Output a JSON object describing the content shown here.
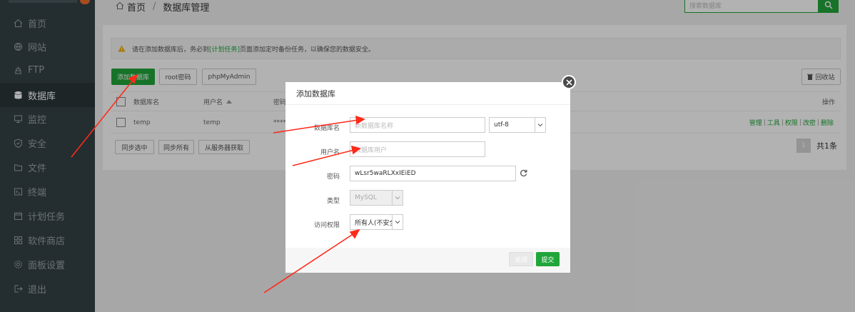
{
  "sidebar": {
    "items": [
      {
        "label": "首页",
        "icon": "home-icon"
      },
      {
        "label": "网站",
        "icon": "globe-icon"
      },
      {
        "label": "FTP",
        "icon": "ftp-icon"
      },
      {
        "label": "数据库",
        "icon": "database-icon",
        "active": true
      },
      {
        "label": "监控",
        "icon": "monitor-icon"
      },
      {
        "label": "安全",
        "icon": "shield-icon"
      },
      {
        "label": "文件",
        "icon": "folder-icon"
      },
      {
        "label": "终端",
        "icon": "terminal-icon"
      },
      {
        "label": "计划任务",
        "icon": "calendar-icon"
      },
      {
        "label": "软件商店",
        "icon": "grid-icon"
      },
      {
        "label": "面板设置",
        "icon": "gear-icon"
      },
      {
        "label": "退出",
        "icon": "logout-icon"
      }
    ]
  },
  "header": {
    "breadcrumb_home": "首页",
    "breadcrumb_sep": "/",
    "breadcrumb_current": "数据库管理",
    "search_placeholder": "搜索数据库"
  },
  "alert": {
    "text_before": "请在添加数据库后，务必到",
    "link": "[计划任务]",
    "text_after": "页面添加定时备份任务，以确保您的数据安全。"
  },
  "toolbar": {
    "add_db": "添加数据库",
    "root_pwd": "root密码",
    "phpmyadmin": "phpMyAdmin",
    "recycle": "回收站"
  },
  "table": {
    "headers": {
      "name": "数据库名",
      "user": "用户名",
      "password": "密码",
      "ops": "操作"
    },
    "rows": [
      {
        "name": "temp",
        "user": "temp",
        "password": "****",
        "ops": [
          "管理",
          "工具",
          "权限",
          "改密",
          "删除"
        ]
      }
    ]
  },
  "bottom": {
    "sync_selected": "同步选中",
    "sync_all": "同步所有",
    "fetch_server": "从服务器获取",
    "page": "1",
    "total": "共1条"
  },
  "modal": {
    "title": "添加数据库",
    "name_label": "数据库名",
    "name_placeholder": "新数据库名称",
    "charset": "utf-8",
    "user_label": "用户名",
    "user_placeholder": "数据库用户",
    "pwd_label": "密码",
    "pwd_value": "wLsr5waRLXxIEiED",
    "type_label": "类型",
    "type_value": "MySQL",
    "access_label": "访问权限",
    "access_value": "所有人(不安全)",
    "close_btn": "关闭",
    "submit_btn": "提交"
  },
  "colors": {
    "accent": "#20a53a",
    "sidebar": "#344146",
    "arrow": "#ff2a1a"
  }
}
